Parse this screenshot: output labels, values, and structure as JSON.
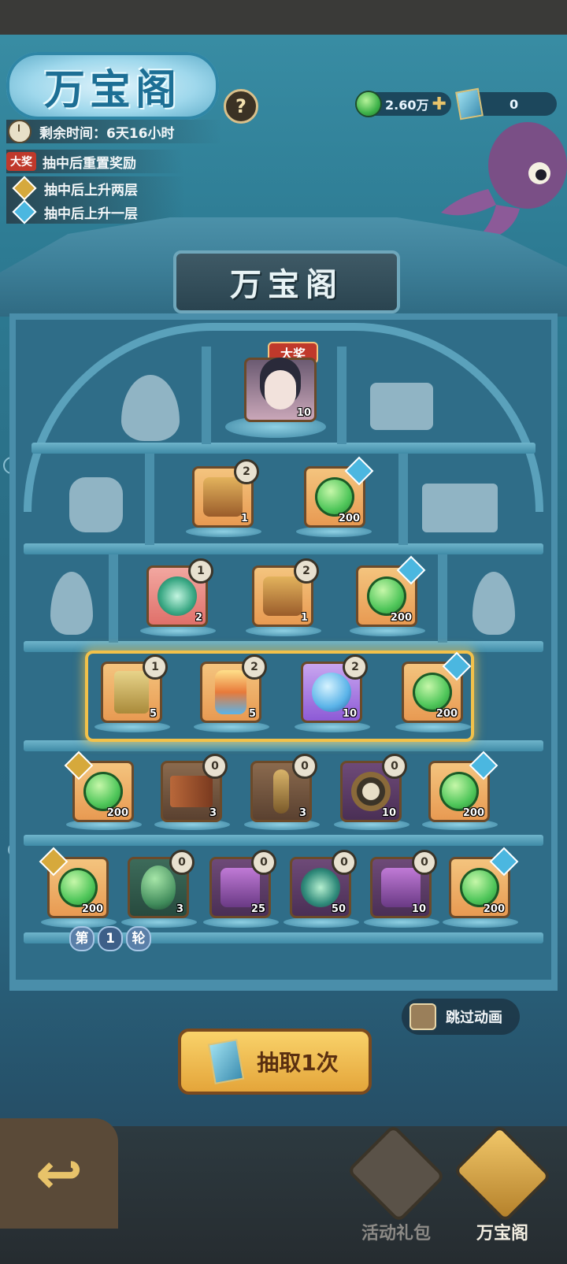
{
  "header": {
    "title": "万宝阁",
    "help_label": "?",
    "jade_amount": "2.60万",
    "ticket_amount": "0",
    "remaining_time_label": "剩余时间：",
    "remaining_time_value": "6天16小时",
    "grand_prize_tag": "大奖",
    "rules": [
      "抽中后重置奖励",
      "抽中后上升两层",
      "抽中后上升一层"
    ]
  },
  "pavilion_plaque": "万宝阁",
  "grand_prize": {
    "tag": "大奖",
    "qty": "10"
  },
  "rows": [
    [
      {
        "icon": "mystery-chest",
        "qty": "1",
        "layer": "2"
      },
      {
        "icon": "jade",
        "qty": "200",
        "badge": "up1"
      }
    ],
    [
      {
        "icon": "swirl-orb",
        "qty": "2",
        "layer": "1"
      },
      {
        "icon": "gold-chest",
        "qty": "1",
        "layer": "2"
      },
      {
        "icon": "jade",
        "qty": "200",
        "badge": "up1"
      }
    ],
    [
      {
        "icon": "talisman-card",
        "qty": "5",
        "layer": "1"
      },
      {
        "icon": "gem-stone",
        "qty": "5",
        "layer": "2"
      },
      {
        "icon": "crystal-ball",
        "qty": "10",
        "layer": "2"
      },
      {
        "icon": "jade",
        "qty": "200",
        "badge": "up1"
      }
    ],
    [
      {
        "icon": "jade",
        "qty": "200",
        "badge": "up2"
      },
      {
        "icon": "scroll",
        "qty": "3",
        "layer": "0"
      },
      {
        "icon": "key",
        "qty": "3",
        "layer": "0"
      },
      {
        "icon": "taiji-disc",
        "qty": "10",
        "layer": "0"
      },
      {
        "icon": "jade",
        "qty": "200",
        "badge": "up1"
      }
    ],
    [
      {
        "icon": "jade",
        "qty": "200",
        "badge": "up2"
      },
      {
        "icon": "egg",
        "qty": "3",
        "layer": "0"
      },
      {
        "icon": "gem-chest",
        "qty": "25",
        "layer": "0"
      },
      {
        "icon": "seed-orb",
        "qty": "50",
        "layer": "0"
      },
      {
        "icon": "purple-chest",
        "qty": "10",
        "layer": "0"
      },
      {
        "icon": "jade",
        "qty": "200",
        "badge": "up1"
      }
    ]
  ],
  "round": {
    "prefix": "第",
    "number": "1",
    "suffix": "轮"
  },
  "skip_animation": "跳过动画",
  "draw_button": "抽取1次",
  "nav": {
    "gift_pack": "活动礼包",
    "treasure_pavilion": "万宝阁"
  },
  "colors": {
    "highlight": "#f2c14a",
    "grand_tag": "#c0392b",
    "up_one": "#4bb7e0",
    "up_two": "#d6a93c"
  }
}
